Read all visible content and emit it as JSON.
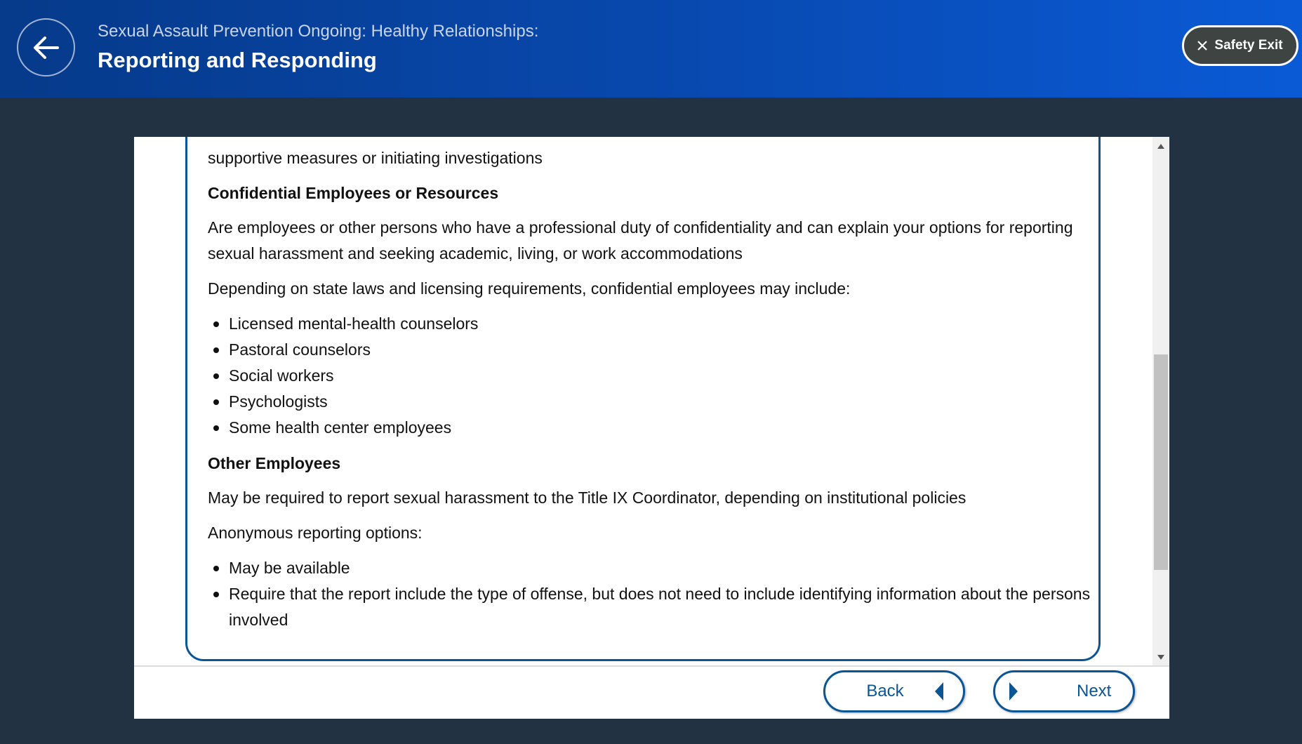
{
  "header": {
    "subtitle": "Sexual Assault Prevention Ongoing: Healthy Relationships:",
    "title": "Reporting and Responding",
    "safety_exit": "Safety Exit"
  },
  "content": {
    "intro": "supportive measures or initiating investigations",
    "confidential": {
      "heading": "Confidential Employees or Resources",
      "desc": "Are employees or other persons who have a professional duty of confidentiality and can explain your options for reporting sexual harassment and seeking academic, living, or work accommodations",
      "lead": "Depending on state laws and licensing requirements, confidential employees may include:",
      "items": [
        "Licensed mental-health counselors",
        "Pastoral counselors",
        "Social workers",
        "Psychologists",
        "Some health center employees"
      ]
    },
    "other": {
      "heading": "Other Employees",
      "desc": "May be required to report sexual harassment to the Title IX Coordinator, depending on institutional policies",
      "lead": "Anonymous reporting options:",
      "items": [
        "May be available",
        "Require that the report include the type of offense, but does not need to include identifying information about the persons involved"
      ]
    }
  },
  "footer": {
    "back": "Back",
    "next": "Next"
  }
}
